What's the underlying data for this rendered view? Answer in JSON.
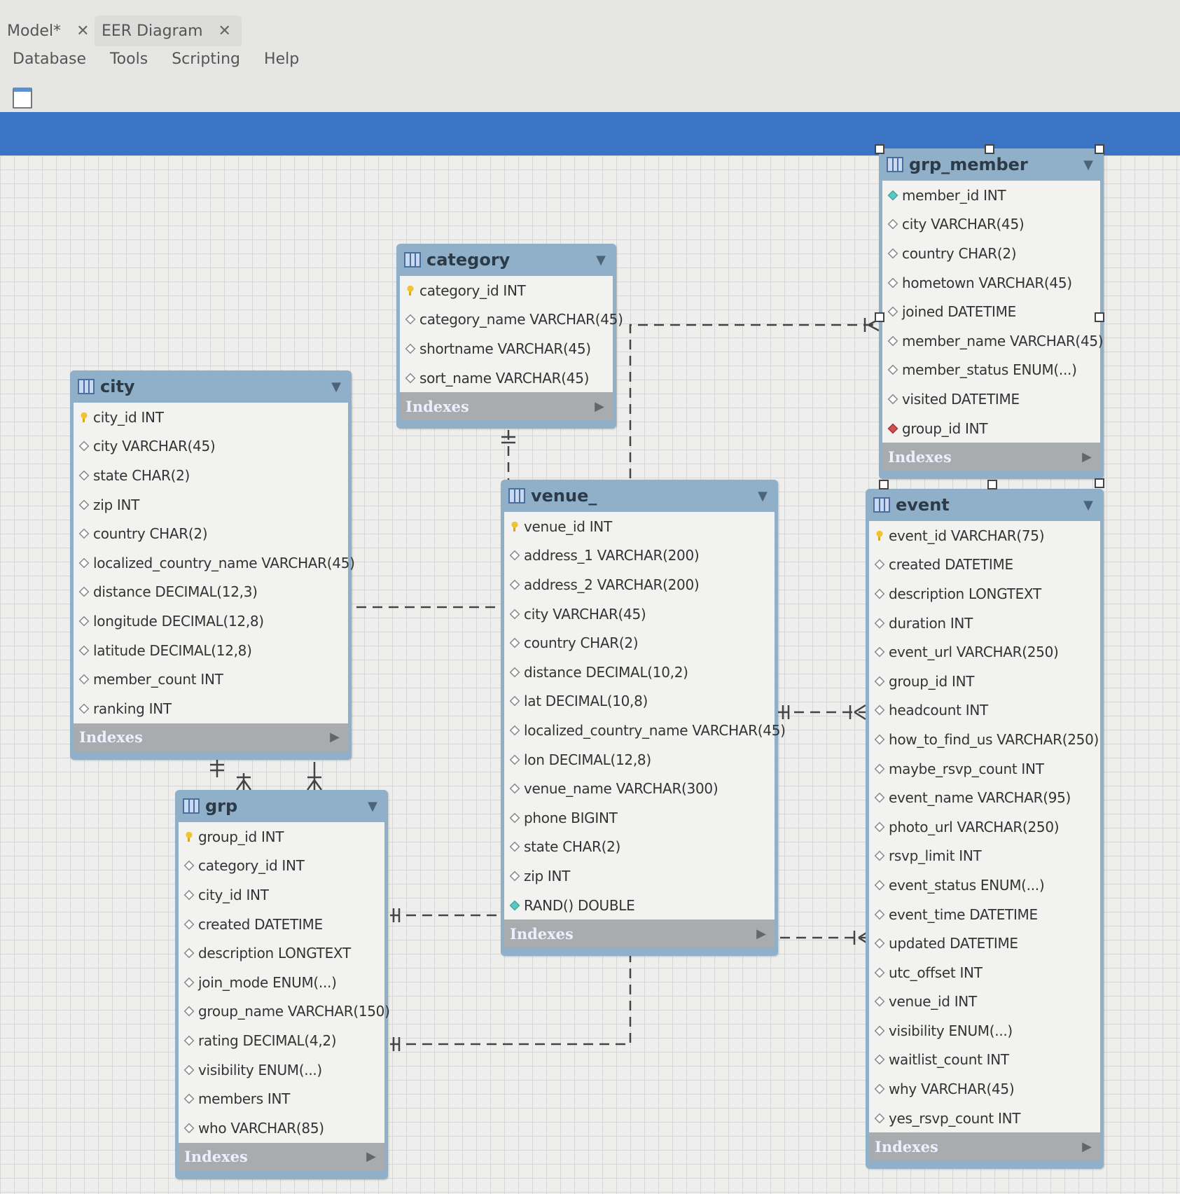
{
  "tabs": [
    {
      "label": "Model*",
      "close": "✕"
    },
    {
      "label": "EER Diagram",
      "close": "✕"
    }
  ],
  "menu": [
    "Database",
    "Tools",
    "Scripting",
    "Help"
  ],
  "indexes_label": "Indexes",
  "colors": {
    "accent_bar": "#3b74c4",
    "table_header": "#8fb0c8",
    "indexes_bar": "#a9acae"
  },
  "tables": {
    "category": {
      "name": "category",
      "columns": [
        {
          "name": "category_id INT",
          "icon": "pk"
        },
        {
          "name": "category_name VARCHAR(45)",
          "icon": "col"
        },
        {
          "name": "shortname VARCHAR(45)",
          "icon": "col"
        },
        {
          "name": "sort_name VARCHAR(45)",
          "icon": "col"
        }
      ]
    },
    "city": {
      "name": "city",
      "columns": [
        {
          "name": "city_id INT",
          "icon": "pk"
        },
        {
          "name": "city VARCHAR(45)",
          "icon": "col"
        },
        {
          "name": "state CHAR(2)",
          "icon": "col"
        },
        {
          "name": "zip INT",
          "icon": "col"
        },
        {
          "name": "country CHAR(2)",
          "icon": "col"
        },
        {
          "name": "localized_country_name VARCHAR(45)",
          "icon": "col"
        },
        {
          "name": "distance DECIMAL(12,3)",
          "icon": "col"
        },
        {
          "name": "longitude DECIMAL(12,8)",
          "icon": "col"
        },
        {
          "name": "latitude DECIMAL(12,8)",
          "icon": "col"
        },
        {
          "name": "member_count INT",
          "icon": "col"
        },
        {
          "name": "ranking INT",
          "icon": "col"
        }
      ]
    },
    "grp_member": {
      "name": "grp_member",
      "columns": [
        {
          "name": "member_id INT",
          "icon": "nn"
        },
        {
          "name": "city VARCHAR(45)",
          "icon": "col"
        },
        {
          "name": "country CHAR(2)",
          "icon": "col"
        },
        {
          "name": "hometown VARCHAR(45)",
          "icon": "col"
        },
        {
          "name": "joined DATETIME",
          "icon": "col"
        },
        {
          "name": "member_name VARCHAR(45)",
          "icon": "col"
        },
        {
          "name": "member_status ENUM(...)",
          "icon": "col"
        },
        {
          "name": "visited DATETIME",
          "icon": "col"
        },
        {
          "name": "group_id INT",
          "icon": "fk"
        }
      ]
    },
    "venue": {
      "name": "venue_",
      "columns": [
        {
          "name": "venue_id INT",
          "icon": "pk"
        },
        {
          "name": "address_1 VARCHAR(200)",
          "icon": "col"
        },
        {
          "name": "address_2 VARCHAR(200)",
          "icon": "col"
        },
        {
          "name": "city VARCHAR(45)",
          "icon": "col"
        },
        {
          "name": "country CHAR(2)",
          "icon": "col"
        },
        {
          "name": "distance DECIMAL(10,2)",
          "icon": "col"
        },
        {
          "name": "lat DECIMAL(10,8)",
          "icon": "col"
        },
        {
          "name": "localized_country_name VARCHAR(45)",
          "icon": "col"
        },
        {
          "name": "lon DECIMAL(12,8)",
          "icon": "col"
        },
        {
          "name": "venue_name VARCHAR(300)",
          "icon": "col"
        },
        {
          "name": "phone BIGINT",
          "icon": "col"
        },
        {
          "name": "state CHAR(2)",
          "icon": "col"
        },
        {
          "name": "zip INT",
          "icon": "col"
        },
        {
          "name": "RAND() DOUBLE",
          "icon": "nn"
        }
      ]
    },
    "event": {
      "name": "event",
      "columns": [
        {
          "name": "event_id VARCHAR(75)",
          "icon": "pk"
        },
        {
          "name": "created DATETIME",
          "icon": "col"
        },
        {
          "name": "description LONGTEXT",
          "icon": "col"
        },
        {
          "name": "duration INT",
          "icon": "col"
        },
        {
          "name": "event_url VARCHAR(250)",
          "icon": "col"
        },
        {
          "name": "group_id INT",
          "icon": "col"
        },
        {
          "name": "headcount INT",
          "icon": "col"
        },
        {
          "name": "how_to_find_us VARCHAR(250)",
          "icon": "col"
        },
        {
          "name": "maybe_rsvp_count INT",
          "icon": "col"
        },
        {
          "name": "event_name VARCHAR(95)",
          "icon": "col"
        },
        {
          "name": "photo_url VARCHAR(250)",
          "icon": "col"
        },
        {
          "name": "rsvp_limit INT",
          "icon": "col"
        },
        {
          "name": "event_status ENUM(...)",
          "icon": "col"
        },
        {
          "name": "event_time DATETIME",
          "icon": "col"
        },
        {
          "name": "updated DATETIME",
          "icon": "col"
        },
        {
          "name": "utc_offset INT",
          "icon": "col"
        },
        {
          "name": "venue_id INT",
          "icon": "col"
        },
        {
          "name": "visibility ENUM(...)",
          "icon": "col"
        },
        {
          "name": "waitlist_count INT",
          "icon": "col"
        },
        {
          "name": "why VARCHAR(45)",
          "icon": "col"
        },
        {
          "name": "yes_rsvp_count INT",
          "icon": "col"
        }
      ]
    },
    "grp": {
      "name": "grp",
      "columns": [
        {
          "name": "group_id INT",
          "icon": "pk"
        },
        {
          "name": "category_id INT",
          "icon": "col"
        },
        {
          "name": "city_id INT",
          "icon": "col"
        },
        {
          "name": "created DATETIME",
          "icon": "col"
        },
        {
          "name": "description LONGTEXT",
          "icon": "col"
        },
        {
          "name": "join_mode ENUM(...)",
          "icon": "col"
        },
        {
          "name": "group_name VARCHAR(150)",
          "icon": "col"
        },
        {
          "name": "rating DECIMAL(4,2)",
          "icon": "col"
        },
        {
          "name": "visibility ENUM(...)",
          "icon": "col"
        },
        {
          "name": "members INT",
          "icon": "col"
        },
        {
          "name": "who VARCHAR(85)",
          "icon": "col"
        }
      ]
    }
  }
}
